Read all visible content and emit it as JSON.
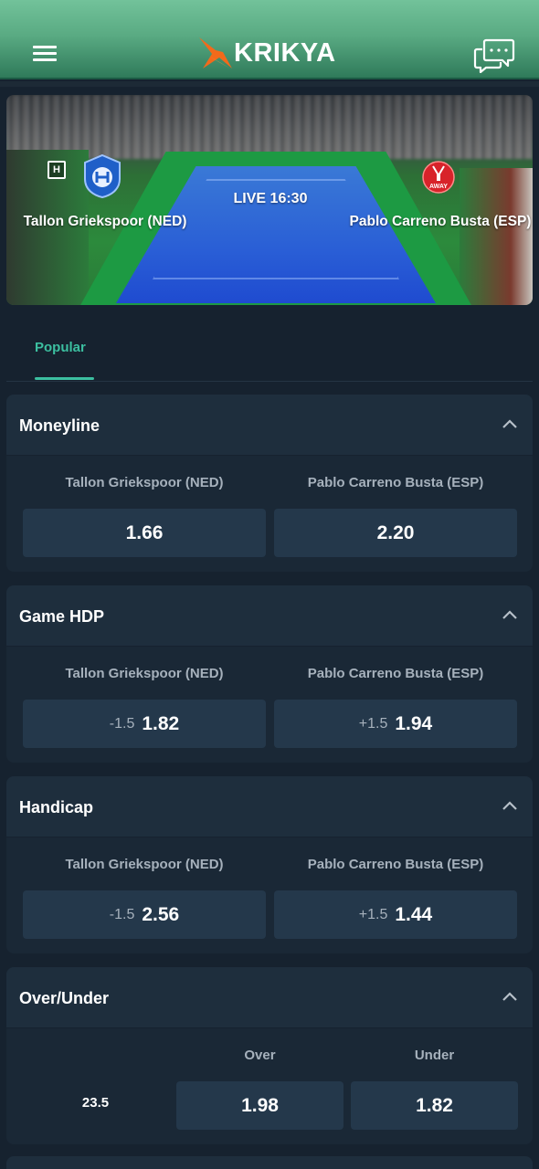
{
  "header": {
    "brand": "KRIKYA",
    "menu_icon": "hamburger-menu-icon",
    "chat_icon": "chat-bubbles-icon",
    "colors": {
      "header_top": "#72c29a",
      "header_bottom": "#2f7a5a",
      "logo_accent": "#f26a1b"
    }
  },
  "match": {
    "home_badge": "H",
    "home_team": "Tallon Griekspoor (NED)",
    "away_team": "Pablo Carreno Busta (ESP)",
    "status": "LIVE 16:30",
    "away_logo_text": "AWAY"
  },
  "tabs": [
    {
      "label": "Popular",
      "active": true
    }
  ],
  "markets": {
    "moneyline": {
      "title": "Moneyline",
      "home_label": "Tallon Griekspoor (NED)",
      "away_label": "Pablo Carreno Busta (ESP)",
      "home_odds": "1.66",
      "away_odds": "2.20"
    },
    "game_hdp": {
      "title": "Game HDP",
      "home_label": "Tallon Griekspoor (NED)",
      "away_label": "Pablo Carreno Busta (ESP)",
      "home_line": "-1.5",
      "home_odds": "1.82",
      "away_line": "+1.5",
      "away_odds": "1.94"
    },
    "handicap": {
      "title": "Handicap",
      "home_label": "Tallon Griekspoor (NED)",
      "away_label": "Pablo Carreno Busta (ESP)",
      "home_line": "-1.5",
      "home_odds": "2.56",
      "away_line": "+1.5",
      "away_odds": "1.44"
    },
    "over_under": {
      "title": "Over/Under",
      "over_label": "Over",
      "under_label": "Under",
      "line": "23.5",
      "over_odds": "1.98",
      "under_odds": "1.82"
    }
  },
  "theme": {
    "accent": "#3cbfa0",
    "background": "#16222f",
    "card": "#1a2836",
    "button": "#24384b",
    "muted_text": "#a6b1bc"
  }
}
